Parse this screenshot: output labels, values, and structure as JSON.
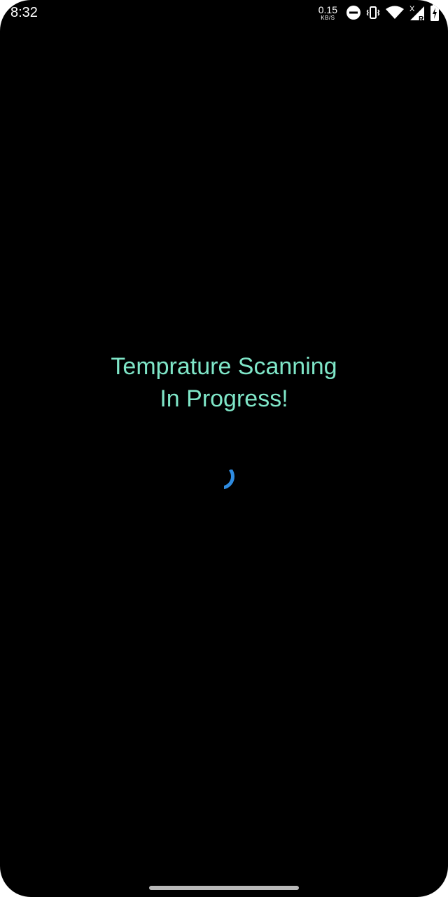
{
  "status_bar": {
    "time": "8:32",
    "net_speed_value": "0.15",
    "net_speed_unit": "KB/S",
    "icons": [
      "do-not-disturb-icon",
      "vibrate-icon",
      "wifi-icon",
      "cell-signal-icon",
      "battery-charging-icon"
    ],
    "signal_marks": {
      "no_data": "X",
      "roaming": "R"
    }
  },
  "main": {
    "message_line1": "Temprature Scanning",
    "message_line2": "In Progress!",
    "message_color": "#7fe6c8",
    "spinner_color": "#2e8be0"
  },
  "navigation": {
    "home_indicator": "gesture-bar"
  }
}
